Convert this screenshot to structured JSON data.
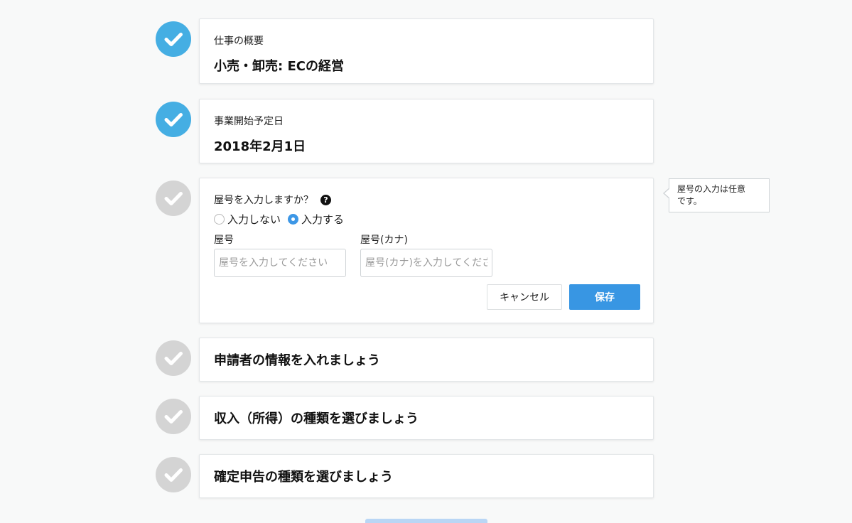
{
  "steps": [
    {
      "status": "done",
      "label": "仕事の概要",
      "value": "小売・卸売: ECの経営"
    },
    {
      "status": "done",
      "label": "事業開始予定日",
      "value": "2018年2月1日"
    },
    {
      "status": "active",
      "question": "屋号を入力しますか？",
      "help_icon": "?",
      "options": [
        "入力しない",
        "入力する"
      ],
      "selected_option": "入力する",
      "fields": [
        {
          "label": "屋号",
          "placeholder": "屋号を入力してください"
        },
        {
          "label": "屋号(カナ)",
          "placeholder": "屋号(カナ)を入力してください"
        }
      ],
      "cancel_label": "キャンセル",
      "save_label": "保存",
      "tooltip_line1": "屋号の入力は任意",
      "tooltip_line2": "です。"
    },
    {
      "status": "todo",
      "title": "申請者の情報を入れましょう"
    },
    {
      "status": "todo",
      "title": "収入（所得）の種類を選びましょう"
    },
    {
      "status": "todo",
      "title": "確定申告の種類を選びましょう"
    }
  ],
  "icons": {
    "done": "check-icon",
    "todo": "check-icon",
    "help": "question-icon"
  },
  "colors": {
    "done": "#45aee3",
    "todo": "#d4d4d4",
    "primary_button": "#3896e3",
    "radio_checked": "#3d97e6"
  }
}
